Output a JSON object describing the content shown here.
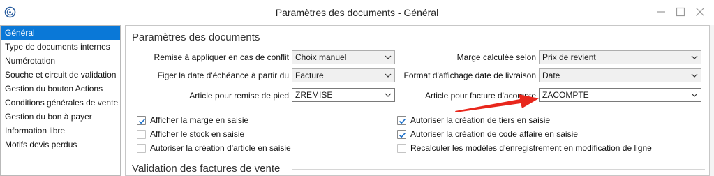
{
  "window": {
    "title": "Paramètres des documents -  Général",
    "logo_icon": "swirl-logo-icon",
    "controls": [
      "minimize-icon",
      "maximize-icon",
      "close-icon"
    ]
  },
  "sidebar": {
    "selected_index": 0,
    "items": [
      {
        "label": "Général"
      },
      {
        "label": "Type de documents internes"
      },
      {
        "label": "Numérotation"
      },
      {
        "label": "Souche et circuit de validation"
      },
      {
        "label": "Gestion du bouton Actions"
      },
      {
        "label": "Conditions générales de vente"
      },
      {
        "label": "Gestion du bon à payer"
      },
      {
        "label": "Information libre"
      },
      {
        "label": "Motifs devis perdus"
      }
    ]
  },
  "main": {
    "section1_title": "Paramètres des documents",
    "section2_title": "Validation des factures de vente",
    "left_fields": [
      {
        "label": "Remise à appliquer en cas de conflit",
        "value": "Choix manuel"
      },
      {
        "label": "Figer la date d'échéance à partir du",
        "value": "Facture"
      },
      {
        "label": "Article pour remise de pied",
        "value": "ZREMISE"
      }
    ],
    "right_fields": [
      {
        "label": "Marge calculée selon",
        "value": "Prix de revient"
      },
      {
        "label": "Format d'affichage date de livraison",
        "value": "Date"
      },
      {
        "label": "Article pour facture d'acompte",
        "value": "ZACOMPTE"
      }
    ],
    "left_checks": [
      {
        "label": "Afficher la marge en saisie",
        "checked": true
      },
      {
        "label": "Afficher le stock en saisie",
        "checked": false
      },
      {
        "label": "Autoriser la création d'article en saisie",
        "checked": false
      }
    ],
    "right_checks": [
      {
        "label": "Autoriser la création de tiers en saisie",
        "checked": true
      },
      {
        "label": "Autoriser la création de code affaire en saisie",
        "checked": true
      },
      {
        "label": "Recalculer les modèles d'enregistrement en modification de ligne",
        "checked": false
      }
    ]
  },
  "colors": {
    "selection": "#0a78d7",
    "annotation_arrow": "#e8271c",
    "check": "#1c6fc9"
  }
}
